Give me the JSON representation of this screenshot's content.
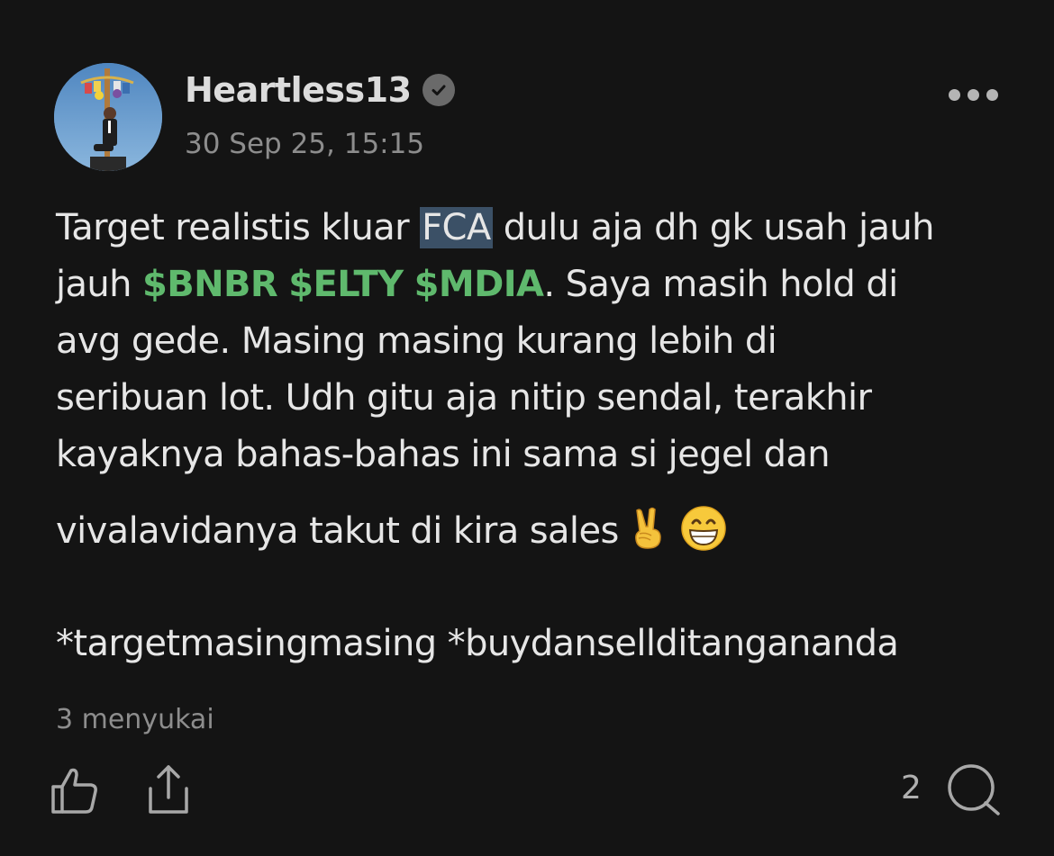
{
  "post": {
    "author": {
      "username": "Heartless13",
      "verified": true,
      "avatar_icon": "avatar-climbing-pole-photo"
    },
    "timestamp": "30 Sep 25, 15:15",
    "more_icon": "more-horizontal-icon",
    "body": {
      "line1_a": "Target realistis kluar ",
      "line1_highlight": "FCA",
      "line1_b": " dulu aja dh gk usah jauh",
      "line2_a": "jauh ",
      "tickers": [
        "$BNBR",
        "$ELTY",
        "$MDIA"
      ],
      "line2_b": ". Saya masih hold di",
      "line3": "avg gede. Masing masing kurang lebih di",
      "line4": "seribuan lot. Udh gitu aja nitip sendal, terakhir",
      "line5": "kayaknya bahas-bahas ini sama si jegel dan",
      "line6": "vivalavidanya takut di kira sales",
      "emojis": [
        "victory-hand-emoji",
        "grinning-face-emoji"
      ],
      "hashtags": "*targetmasingmasing *buydansellditangananda"
    },
    "likes_text": "3 menyukai",
    "comment_count": "2",
    "actions": {
      "like_icon": "thumbs-up-icon",
      "share_icon": "share-icon",
      "comment_icon": "comment-icon"
    },
    "colors": {
      "background": "#141414",
      "ticker": "#5fb96d",
      "highlight": "#3b5066",
      "muted": "#8d8d8d"
    }
  }
}
